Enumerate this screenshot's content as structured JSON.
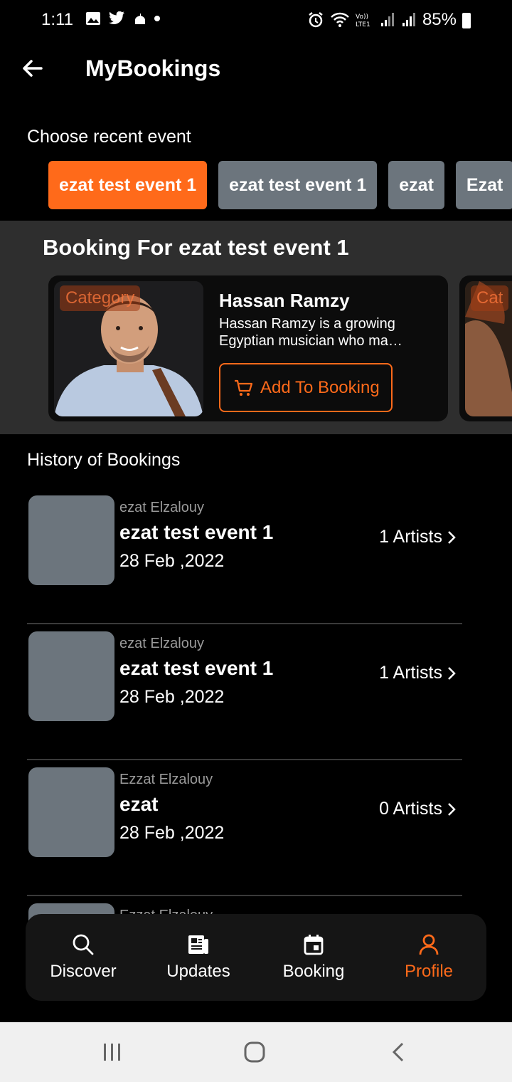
{
  "status_bar": {
    "time": "1:11",
    "battery": "85%"
  },
  "header": {
    "title": "MyBookings"
  },
  "choose": {
    "label": "Choose recent event",
    "chips": [
      {
        "label": "ezat test event 1",
        "active": true
      },
      {
        "label": "ezat test event 1",
        "active": false
      },
      {
        "label": "ezat",
        "active": false
      },
      {
        "label": "Ezat",
        "active": false
      }
    ]
  },
  "booking": {
    "title": "Booking For ezat test event 1",
    "cards": [
      {
        "category": "Category",
        "name": "Hassan Ramzy",
        "description": "Hassan Ramzy is a growing Egyptian musician who ma…",
        "button_label": "Add To Booking"
      },
      {
        "category": "Cat"
      }
    ]
  },
  "history": {
    "label": "History of Bookings",
    "items": [
      {
        "organizer": "ezat Elzalouy",
        "event": "ezat test event 1",
        "date": "28 Feb ,2022",
        "artists": "1 Artists"
      },
      {
        "organizer": "ezat Elzalouy",
        "event": "ezat test event 1",
        "date": "28 Feb ,2022",
        "artists": "1 Artists"
      },
      {
        "organizer": "Ezzat Elzalouy",
        "event": "ezat",
        "date": "28 Feb ,2022",
        "artists": "0 Artists"
      },
      {
        "organizer": "Ezzat Elzalouy",
        "event": "",
        "date": "",
        "artists": ""
      }
    ]
  },
  "nav": {
    "items": [
      {
        "label": "Discover",
        "icon": "search-icon"
      },
      {
        "label": "Updates",
        "icon": "newspaper-icon"
      },
      {
        "label": "Booking",
        "icon": "calendar-icon"
      },
      {
        "label": "Profile",
        "icon": "person-icon",
        "active": true
      }
    ]
  },
  "colors": {
    "accent": "#ff6a1a",
    "chip_inactive": "#6c757d",
    "section_bg": "#2e2e2e"
  }
}
